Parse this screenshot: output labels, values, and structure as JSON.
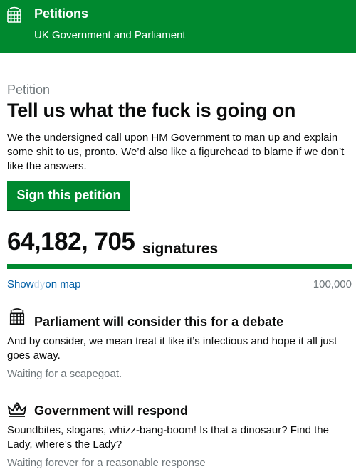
{
  "header": {
    "title": "Petitions",
    "subtitle": "UK Government and Parliament",
    "icon": "portcullis-icon",
    "brand_color": "#00892f"
  },
  "petition": {
    "kicker": "Petition",
    "title": "Tell us what the fuck is going on",
    "description": "We the undersigned call upon HM Government to man up and explain some shit to us, pronto. We’d also like a figurehead to blame if we don’t like the answers.",
    "sign_button": "Sign this petition"
  },
  "signatures": {
    "count": "64,182, 705",
    "label": "signatures",
    "progress_fraction": 1.0,
    "threshold": "100,000"
  },
  "map_link": {
    "part1": "Show",
    "part2": "dy",
    "part3": "on",
    "part4": "map"
  },
  "sections": {
    "parliament": {
      "icon": "portcullis-icon",
      "title": "Parliament will consider this for a debate",
      "text": "And by consider, we mean treat it like it’s infectious and hope it all just goes away.",
      "status": "Waiting for a scapegoat."
    },
    "government": {
      "icon": "crown-icon",
      "title": "Government will respond",
      "text": "Soundbites, slogans, whizz-bang-boom! Is that a dinosaur? Find the Lady, where’s the Lady?",
      "status": "Waiting forever for a reasonable response"
    }
  }
}
